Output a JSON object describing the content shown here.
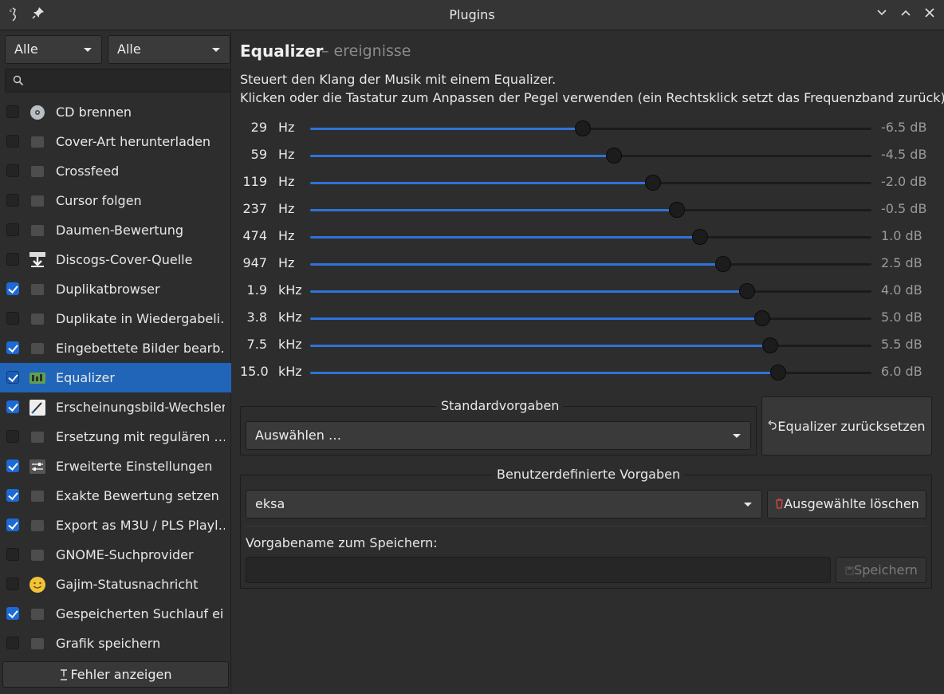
{
  "window": {
    "title": "Plugins"
  },
  "sidebar": {
    "filter1": "Alle",
    "filter2": "Alle",
    "search_placeholder": "",
    "items": [
      {
        "label": "CD brennen",
        "checked": false,
        "icon": "cd-icon",
        "color": "#9aa0a8",
        "bright": true
      },
      {
        "label": "Cover-Art herunterladen",
        "checked": false,
        "icon": "image-icon",
        "color": "#8a8a8a",
        "bright": false
      },
      {
        "label": "Crossfeed",
        "checked": false,
        "icon": "speaker-icon",
        "color": "#8a8a8a",
        "bright": false
      },
      {
        "label": "Cursor folgen",
        "checked": false,
        "icon": "arrow-icon",
        "color": "#8a8a8a",
        "bright": false
      },
      {
        "label": "Daumen-Bewertung",
        "checked": false,
        "icon": "thumb-icon",
        "color": "#8a8a8a",
        "bright": false
      },
      {
        "label": "Discogs-Cover-Quelle",
        "checked": false,
        "icon": "download-icon",
        "color": "#e8e8e8",
        "bright": true
      },
      {
        "label": "Duplikatbrowser",
        "checked": true,
        "icon": "grid-icon",
        "color": "#8a8a8a",
        "bright": false
      },
      {
        "label": "Duplikate in Wiedergabeli…",
        "checked": false,
        "icon": "backspace-icon",
        "color": "#8a8a8a",
        "bright": false
      },
      {
        "label": "Eingebettete Bilder bearb…",
        "checked": true,
        "icon": "image-edit-icon",
        "color": "#8a8a8a",
        "bright": false
      },
      {
        "label": "Equalizer",
        "checked": true,
        "icon": "equalizer-icon",
        "color": "#5fa04e",
        "bright": true
      },
      {
        "label": "Erscheinungsbild-Wechsler",
        "checked": true,
        "icon": "theme-brush-icon",
        "color": "#e8e8e8",
        "bright": true
      },
      {
        "label": "Ersetzung mit regulären …",
        "checked": false,
        "icon": "find-replace-icon",
        "color": "#8a8a8a",
        "bright": false
      },
      {
        "label": "Erweiterte Einstellungen",
        "checked": true,
        "icon": "settings-sliders-icon",
        "color": "#cfcfcf",
        "bright": true
      },
      {
        "label": "Exakte Bewertung setzen",
        "checked": true,
        "icon": "rating-icon",
        "color": "#8a8a8a",
        "bright": false
      },
      {
        "label": "Export as M3U / PLS Playl…",
        "checked": true,
        "icon": "export-icon",
        "color": "#8a8a8a",
        "bright": false
      },
      {
        "label": "GNOME-Suchprovider",
        "checked": false,
        "icon": "search-provider-icon",
        "color": "#8a8a8a",
        "bright": false
      },
      {
        "label": "Gajim-Statusnachricht",
        "checked": false,
        "icon": "smiley-icon",
        "color": "#f2c23a",
        "bright": true
      },
      {
        "label": "Gespeicherten Suchlauf ei…",
        "checked": true,
        "icon": "saved-search-icon",
        "color": "#8a8a8a",
        "bright": false
      },
      {
        "label": "Grafik speichern",
        "checked": false,
        "icon": "save-image-icon",
        "color": "#8a8a8a",
        "bright": false
      }
    ],
    "selected_index": 9,
    "errors_button": "Fehler anzeigen"
  },
  "plugin": {
    "name": "Equalizer",
    "subtitle": "– ereignisse",
    "description_line1": "Steuert den Klang der Musik mit einem Equalizer.",
    "description_line2": "Klicken oder die Tastatur zum Anpassen der Pegel verwenden (ein Rechtsklick setzt das Frequenzband zurück).",
    "bands": [
      {
        "freq": "29",
        "unit": "Hz",
        "db_label": "-6.5 dB",
        "db": -6.5
      },
      {
        "freq": "59",
        "unit": "Hz",
        "db_label": "-4.5 dB",
        "db": -4.5
      },
      {
        "freq": "119",
        "unit": "Hz",
        "db_label": "-2.0 dB",
        "db": -2.0
      },
      {
        "freq": "237",
        "unit": "Hz",
        "db_label": "-0.5 dB",
        "db": -0.5
      },
      {
        "freq": "474",
        "unit": "Hz",
        "db_label": "1.0 dB",
        "db": 1.0
      },
      {
        "freq": "947",
        "unit": "Hz",
        "db_label": "2.5 dB",
        "db": 2.5
      },
      {
        "freq": "1.9",
        "unit": "kHz",
        "db_label": "4.0 dB",
        "db": 4.0
      },
      {
        "freq": "3.8",
        "unit": "kHz",
        "db_label": "5.0 dB",
        "db": 5.0
      },
      {
        "freq": "7.5",
        "unit": "kHz",
        "db_label": "5.5 dB",
        "db": 5.5
      },
      {
        "freq": "15.0",
        "unit": "kHz",
        "db_label": "6.0 dB",
        "db": 6.0
      }
    ],
    "db_min": -24,
    "db_max": 12,
    "presets": {
      "title": "Standardvorgaben",
      "selected": "Auswählen …",
      "reset_button": "Equalizer zurücksetzen"
    },
    "custom": {
      "title": "Benutzerdefinierte Vorgaben",
      "selected": "eksa",
      "delete_button": "Ausgewählte löschen",
      "name_label": "Vorgabename zum Speichern:",
      "name_value": "",
      "save_button": "Speichern"
    }
  },
  "colors": {
    "accent": "#2065b8",
    "fill": "#2f73d9",
    "delete": "#e04848"
  }
}
